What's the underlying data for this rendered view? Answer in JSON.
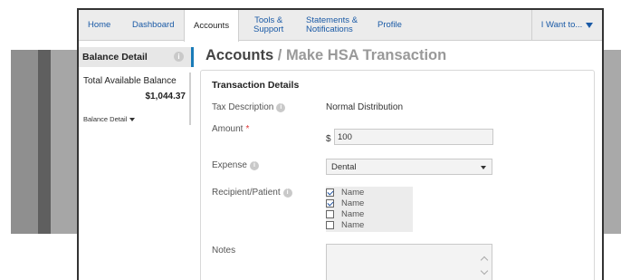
{
  "nav": {
    "items": [
      {
        "label": "Home"
      },
      {
        "label": "Dashboard"
      },
      {
        "label": "Accounts"
      },
      {
        "label": "Tools &\nSupport"
      },
      {
        "label": "Statements &\nNotifications"
      },
      {
        "label": "Profile"
      }
    ],
    "i_want": "I Want to..."
  },
  "sidebar": {
    "title": "Balance Detail",
    "balance_label": "Total Available Balance",
    "balance_amount": "$1,044.37",
    "detail_toggle": "Balance Detail"
  },
  "page": {
    "title_main": "Accounts",
    "title_sub": " / Make HSA Transaction"
  },
  "form": {
    "title": "Transaction Details",
    "tax_label": "Tax Description",
    "tax_value": "Normal Distribution",
    "amount_label": "Amount",
    "amount_required": "*",
    "currency": "$",
    "amount_value": "100",
    "expense_label": "Expense",
    "expense_value": "Dental",
    "recipient_label": "Recipient/Patient",
    "recipients": [
      {
        "name": "Name",
        "checked": true
      },
      {
        "name": "Name",
        "checked": true
      },
      {
        "name": "Name",
        "checked": false
      },
      {
        "name": "Name",
        "checked": false
      }
    ],
    "notes_label": "Notes"
  },
  "colors": {
    "link": "#1a5aa6",
    "accent": "#1a7bb8",
    "required": "#dd3333"
  }
}
